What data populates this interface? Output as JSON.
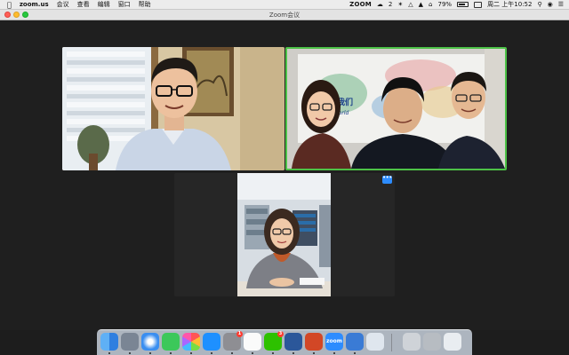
{
  "menubar": {
    "app_name": "zoom.us",
    "menus": [
      "会议",
      "查看",
      "编辑",
      "窗口",
      "帮助"
    ],
    "status": {
      "zoom_label": "ZOOM",
      "wechat_count": "2",
      "battery": "79%",
      "datetime": "周二 上午10:52"
    }
  },
  "window": {
    "title": "Zoom会议"
  },
  "colors": {
    "active_speaker": "#4dc247",
    "more_button": "#2d8cff"
  },
  "participants": [
    {
      "id": "p1",
      "tile": "top-left"
    },
    {
      "id": "p2",
      "tile": "top-right",
      "active_speaker": true,
      "background_text": "走近我们",
      "background_text_en": "the World"
    },
    {
      "id": "p3",
      "tile": "bottom-center"
    }
  ],
  "tile_menu_label": "•••",
  "dock": {
    "apps": [
      {
        "name": "finder"
      },
      {
        "name": "launchpad"
      },
      {
        "name": "safari"
      },
      {
        "name": "facetime"
      },
      {
        "name": "photos"
      },
      {
        "name": "app-store"
      },
      {
        "name": "system-preferences",
        "badge": "1"
      },
      {
        "name": "qq"
      },
      {
        "name": "wechat",
        "badge": "3"
      },
      {
        "name": "word"
      },
      {
        "name": "powerpoint"
      },
      {
        "name": "zoom",
        "label": "zoom"
      },
      {
        "name": "baidu-netdisk"
      },
      {
        "name": "preview"
      },
      {
        "name": "scanner"
      },
      {
        "name": "printer"
      },
      {
        "name": "trash"
      }
    ]
  }
}
